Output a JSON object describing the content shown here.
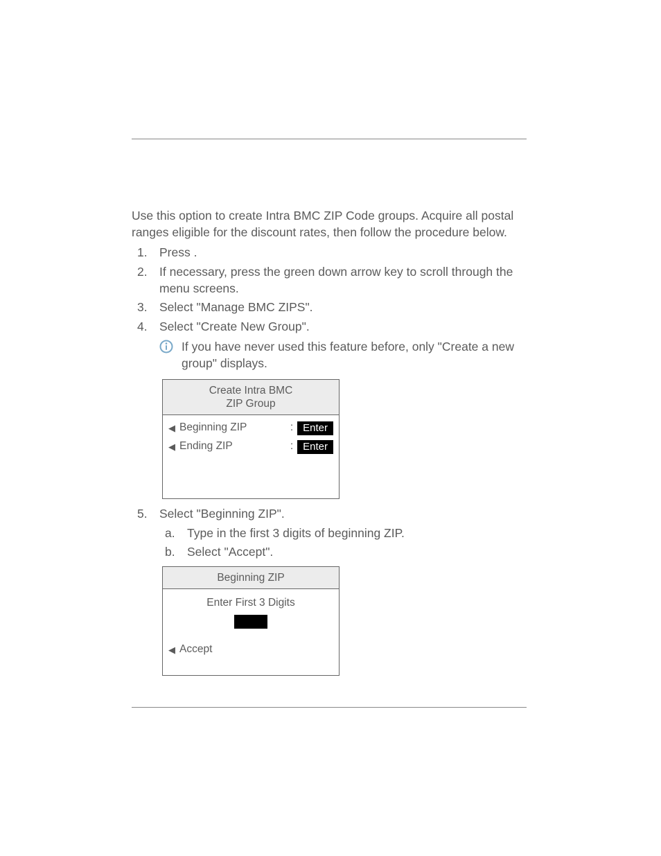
{
  "intro": "Use this option to create Intra BMC ZIP Code groups. Acquire all postal ranges eligible for the discount rates, then follow the procedure below.",
  "steps": {
    "s1_prefix": "Press ",
    "s1_suffix": ".",
    "s2": "If necessary, press the green down arrow key to scroll through the menu screens.",
    "s3": "Select \"Manage BMC ZIPS\".",
    "s4": "Select \"Create New Group\".",
    "s5": "Select \"Beginning ZIP\".",
    "s5a": "Type in the first 3 digits of beginning ZIP.",
    "s5b": "Select \"Accept\"."
  },
  "note": "If you have never used this feature before, only \"Create a new group\" displays.",
  "screen1": {
    "title_line1": "Create Intra BMC",
    "title_line2": "ZIP Group",
    "row1_label": "Beginning ZIP",
    "row2_label": "Ending ZIP",
    "enter": "Enter"
  },
  "screen2": {
    "title": "Beginning ZIP",
    "subhead": "Enter First 3 Digits",
    "accept": "Accept"
  },
  "sub_markers": {
    "a": "a.",
    "b": "b."
  }
}
